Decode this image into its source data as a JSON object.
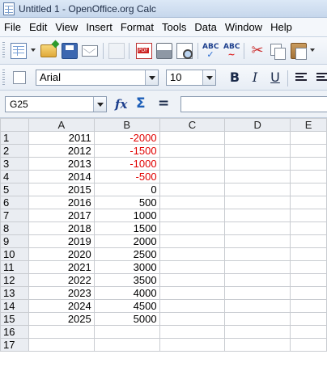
{
  "window": {
    "title": "Untitled 1 - OpenOffice.org Calc"
  },
  "menu": [
    "File",
    "Edit",
    "View",
    "Insert",
    "Format",
    "Tools",
    "Data",
    "Window",
    "Help"
  ],
  "formatting": {
    "font_name": "Arial",
    "font_size": "10"
  },
  "formula_bar": {
    "cell_ref": "G25",
    "content": ""
  },
  "sheet": {
    "columns": [
      "A",
      "B",
      "C",
      "D",
      "E"
    ],
    "rows": [
      {
        "n": "1",
        "a": "2011",
        "b": "-2000"
      },
      {
        "n": "2",
        "a": "2012",
        "b": "-1500"
      },
      {
        "n": "3",
        "a": "2013",
        "b": "-1000"
      },
      {
        "n": "4",
        "a": "2014",
        "b": "-500"
      },
      {
        "n": "5",
        "a": "2015",
        "b": "0"
      },
      {
        "n": "6",
        "a": "2016",
        "b": "500"
      },
      {
        "n": "7",
        "a": "2017",
        "b": "1000"
      },
      {
        "n": "8",
        "a": "2018",
        "b": "1500"
      },
      {
        "n": "9",
        "a": "2019",
        "b": "2000"
      },
      {
        "n": "10",
        "a": "2020",
        "b": "2500"
      },
      {
        "n": "11",
        "a": "2021",
        "b": "3000"
      },
      {
        "n": "12",
        "a": "2022",
        "b": "3500"
      },
      {
        "n": "13",
        "a": "2023",
        "b": "4000"
      },
      {
        "n": "14",
        "a": "2024",
        "b": "4500"
      },
      {
        "n": "15",
        "a": "2025",
        "b": "5000"
      },
      {
        "n": "16",
        "a": "",
        "b": ""
      },
      {
        "n": "17",
        "a": "",
        "b": ""
      }
    ]
  },
  "colors": {
    "negative": "#e00000"
  }
}
